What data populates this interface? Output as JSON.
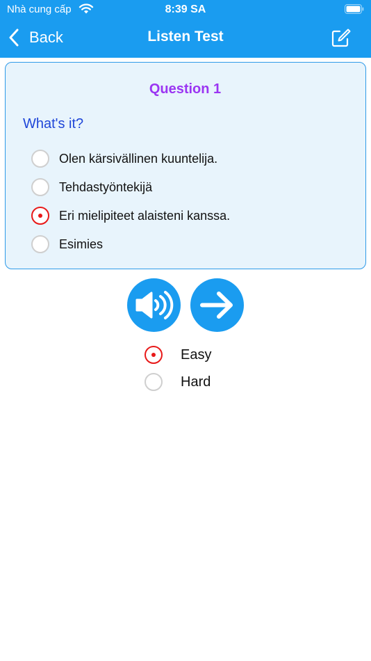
{
  "status_bar": {
    "carrier": "Nhà cung cấp",
    "time": "8:39 SA"
  },
  "nav": {
    "back_label": "Back",
    "title": "Listen Test"
  },
  "question": {
    "title": "Question 1",
    "prompt": "What's it?",
    "options": [
      {
        "label": "Olen kärsivällinen kuuntelija.",
        "selected": false
      },
      {
        "label": "Tehdastyöntekijä",
        "selected": false
      },
      {
        "label": "Eri mielipiteet alaisteni kanssa.",
        "selected": true
      },
      {
        "label": "Esimies",
        "selected": false
      }
    ]
  },
  "levels": [
    {
      "label": "Easy",
      "selected": true
    },
    {
      "label": "Hard",
      "selected": false
    }
  ],
  "colors": {
    "accent": "#1a9cf0",
    "question_title": "#9b35f2",
    "prompt": "#1f46d8",
    "radio_selected": "#e81919"
  },
  "icons": {
    "back": "chevron-left-icon",
    "edit": "edit-icon",
    "audio": "speaker-icon",
    "next": "arrow-right-icon"
  }
}
